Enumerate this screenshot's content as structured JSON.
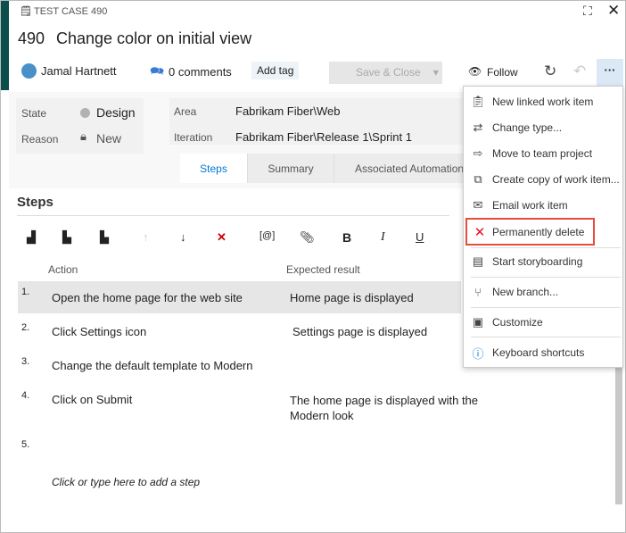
{
  "header": {
    "type_label": "TEST CASE 490",
    "id": "490",
    "title": "Change color on initial view",
    "assignee": "Jamal Hartnett",
    "comments": "0 comments",
    "add_tag": "Add tag",
    "save_close": "Save & Close",
    "follow": "Follow"
  },
  "fields": {
    "state_label": "State",
    "state_value": "Design",
    "reason_label": "Reason",
    "reason_value": "New",
    "area_label": "Area",
    "area_value": "Fabrikam Fiber\\Web",
    "iteration_label": "Iteration",
    "iteration_value": "Fabrikam Fiber\\Release 1\\Sprint 1"
  },
  "tabs": [
    {
      "label": "Steps",
      "active": true
    },
    {
      "label": "Summary"
    },
    {
      "label": "Associated Automation"
    }
  ],
  "steps": {
    "heading": "Steps",
    "col_action": "Action",
    "col_expected": "Expected result",
    "rows": [
      {
        "num": "1.",
        "action": "Open the home page for the web site",
        "expected": "Home page is displayed"
      },
      {
        "num": "2.",
        "action": "Click Settings icon",
        "expected": "Settings page is displayed"
      },
      {
        "num": "3.",
        "action": "Change the default template to Modern",
        "expected": ""
      },
      {
        "num": "4.",
        "action": "Click on Submit",
        "expected": "The home page is displayed with the Modern look"
      },
      {
        "num": "5.",
        "action": "",
        "expected": ""
      }
    ],
    "add_step": "Click or type here to add a step"
  },
  "menu": {
    "items": [
      {
        "label": "New linked work item",
        "icon": "clipboard-check-icon"
      },
      {
        "label": "Change type...",
        "icon": "swap-arrows-icon"
      },
      {
        "label": "Move to team project",
        "icon": "move-icon"
      },
      {
        "label": "Create copy of work item...",
        "icon": "copy-icon"
      },
      {
        "label": "Email work item",
        "icon": "mail-icon"
      },
      {
        "label": "Permanently delete",
        "icon": "x-icon",
        "highlighted": true
      },
      {
        "label": "Start storyboarding",
        "icon": "storyboard-icon"
      },
      {
        "label": "New branch...",
        "icon": "branch-icon"
      },
      {
        "label": "Customize",
        "icon": "customize-icon"
      },
      {
        "label": "Keyboard shortcuts",
        "icon": "info-icon"
      }
    ]
  },
  "colors": {
    "accent": "#0a4f4c",
    "link": "#0078d4",
    "delete": "#e81123",
    "highlight_border": "#e74c3c"
  }
}
